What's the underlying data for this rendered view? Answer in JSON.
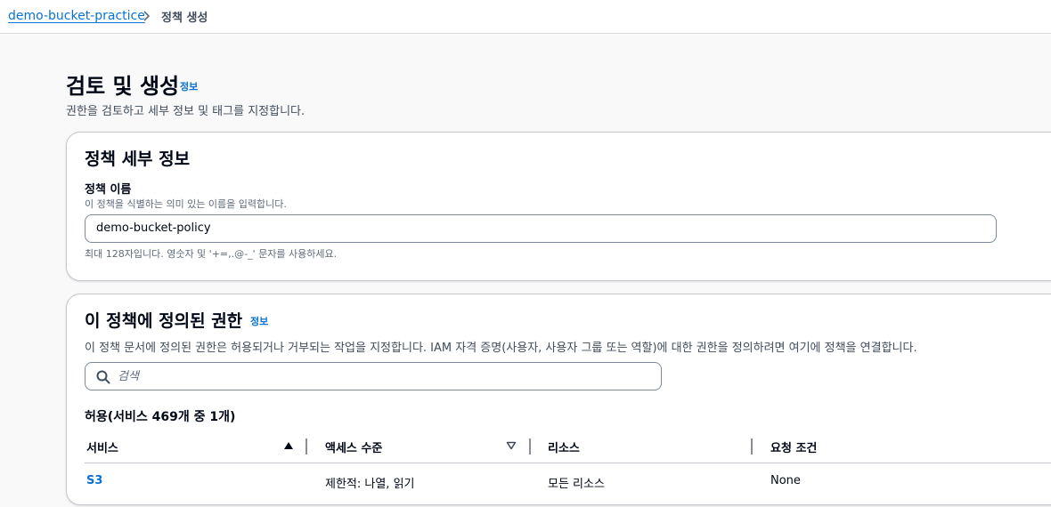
{
  "breadcrumb": {
    "parent": "demo-bucket-practice",
    "current": "정책 생성"
  },
  "page": {
    "title": "검토 및 생성",
    "info": "정보",
    "description": "권한을 검토하고 세부 정보 및 태그를 지정합니다."
  },
  "policy_details": {
    "title": "정책 세부 정보",
    "name_label": "정책 이름",
    "name_description": "이 정책을 식별하는 의미 있는 이름을 입력합니다.",
    "name_value": "demo-bucket-policy",
    "name_hint": "최대 128자입니다. 영숫자 및 '+=,.@-_' 문자를 사용하세요."
  },
  "permissions": {
    "title": "이 정책에 정의된 권한",
    "info": "정보",
    "description": "이 정책 문서에 정의된 권한은 허용되거나 거부되는 작업을 지정합니다. IAM 자격 증명(사용자, 사용자 그룹 또는 역할)에 대한 권한을 정의하려면 여기에 정책을 연결합니다.",
    "search_placeholder": "검색",
    "allowed_title": "허용(서비스 469개 중 1개)",
    "columns": {
      "service": "서비스",
      "access_level": "액세스 수준",
      "resource": "리소스",
      "request_condition": "요청 조건"
    },
    "rows": [
      {
        "service": "S3",
        "access_level": "제한적: 나열, 읽기",
        "resource": "모든 리소스",
        "request_condition": "None"
      }
    ]
  },
  "colors": {
    "link": "#0972d3",
    "text": "#000716",
    "border": "#c6c6cd",
    "input_border": "#7d8998"
  },
  "icons": {
    "breadcrumb_separator": "chevron-right-icon",
    "search": "search-icon",
    "sort_asc": "caret-up-icon",
    "sort_desc": "caret-down-outline-icon"
  }
}
